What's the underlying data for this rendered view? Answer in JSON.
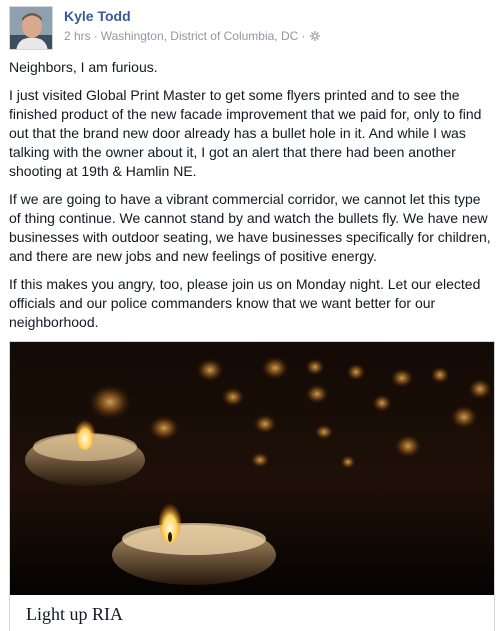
{
  "post": {
    "author": "Kyle Todd",
    "time": "2 hrs",
    "location": "Washington, District of Columbia, DC",
    "separator": "·",
    "audience_icon": "gear-icon",
    "paragraphs": [
      "Neighbors, I am furious.",
      "I just visited Global Print Master to get some flyers printed and to see the finished product of the new facade improvement that we paid for, only to find out that the brand new door already has a bullet hole in it. And while I was talking with the owner about it, I got an alert that there had been another shooting at 19th & Hamlin NE.",
      "If we are going to have a vibrant commercial corridor, we cannot let this type of thing continue. We cannot stand by and watch the bullets fly. We have new businesses with outdoor seating, we have businesses specifically for children, and there are new jobs and new feelings of positive energy.",
      "If this makes you angry, too, please join us on Monday night. Let our elected officials and our police commanders know that we want better for our neighborhood."
    ]
  },
  "attachment": {
    "image_subject": "candles",
    "caption": "Light up RIA"
  },
  "colors": {
    "author_link": "#3b5998",
    "meta_text": "#9197a3",
    "body_text": "#141823",
    "card_border": "#d3d6db"
  }
}
